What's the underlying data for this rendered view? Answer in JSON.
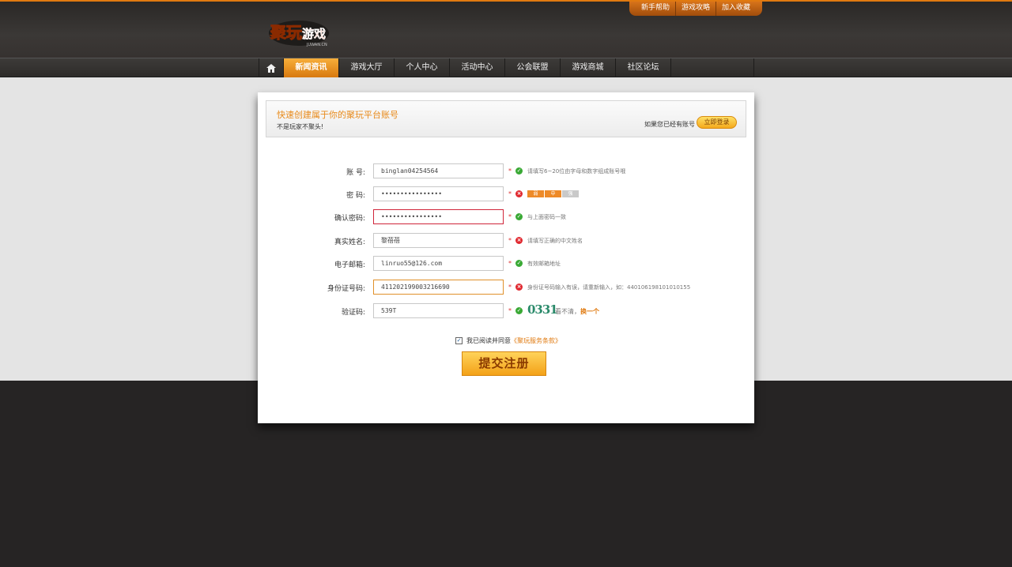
{
  "header": {
    "logo_text": "聚玩游戏",
    "logo_sub": "JUWAN.CN",
    "top_links": [
      "新手帮助",
      "游戏攻略",
      "加入收藏"
    ]
  },
  "nav": {
    "home_icon": "home-icon",
    "items": [
      "新闻资讯",
      "游戏大厅",
      "个人中心",
      "活动中心",
      "公会联盟",
      "游戏商城",
      "社区论坛"
    ],
    "active_index": 0
  },
  "banner": {
    "title": "快速创建属于你的聚玩平台账号",
    "subtitle": "不是玩家不聚头!",
    "login_hint": "如果您已经有账号",
    "login_button": "立即登录"
  },
  "form": {
    "account": {
      "label": "账    号:",
      "value": "binglan04254564",
      "status": "ok",
      "hint": "请填写6~20位由字母和数字组成账号哦"
    },
    "password": {
      "label": "密    码:",
      "value": "••••••••••••••••",
      "status": "error",
      "strength": [
        "弱",
        "中",
        "强"
      ]
    },
    "confirm": {
      "label": "确认密码:",
      "value": "••••••••••••••••",
      "status": "ok",
      "hint": "与上面密码一致"
    },
    "realname": {
      "label": "真实姓名:",
      "value": "黎蓓蓓",
      "status": "error",
      "hint": "请填写正确的中文姓名"
    },
    "email": {
      "label": "电子邮箱:",
      "value": "linruo55@126.com",
      "status": "ok",
      "hint": "有效邮箱地址"
    },
    "idcard": {
      "label": "身份证号码:",
      "value": "411202199003216690",
      "status": "error",
      "hint": "身份证号码输入有误，请重新输入，如：440106198101010155"
    },
    "captcha": {
      "label": "验证码:",
      "value": "539T",
      "status": "ok",
      "image_text": "0331",
      "hint": "看不清，",
      "refresh": "换一个"
    }
  },
  "agree": {
    "checked": true,
    "text": "我已阅读并同意",
    "terms": "《聚玩服务条款》"
  },
  "submit_label": "提交注册",
  "colors": {
    "accent": "#e07a10",
    "ok": "#3aa935",
    "error": "#e0282f"
  }
}
